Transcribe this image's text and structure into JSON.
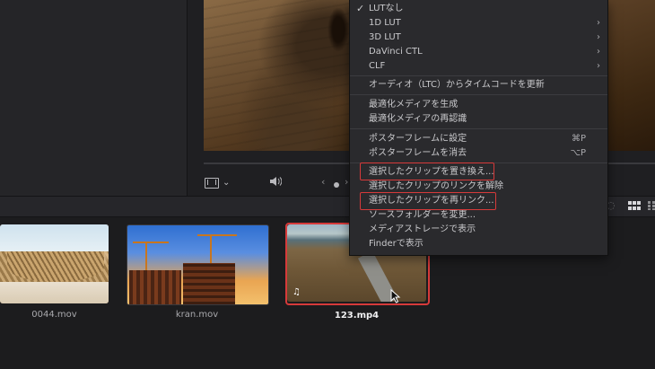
{
  "viewer": {
    "controls": [
      "film-icon",
      "chevron-down-icon",
      "volume-icon",
      "prev-icon",
      "dot-icon",
      "next-icon"
    ]
  },
  "context_menu": {
    "items": [
      {
        "label": "LUTなし",
        "checked": true,
        "submenu": false
      },
      {
        "label": "1D LUT",
        "checked": false,
        "submenu": true
      },
      {
        "label": "3D LUT",
        "checked": false,
        "submenu": true
      },
      {
        "label": "DaVinci CTL",
        "checked": false,
        "submenu": true
      },
      {
        "label": "CLF",
        "checked": false,
        "submenu": true
      },
      {
        "label": "オーディオ（LTC）からタイムコードを更新"
      },
      {
        "label": "最適化メディアを生成"
      },
      {
        "label": "最適化メディアの再認識"
      },
      {
        "label": "ポスターフレームに設定",
        "shortcut": "⌘P"
      },
      {
        "label": "ポスターフレームを消去",
        "shortcut": "⌥P"
      },
      {
        "label": "選択したクリップを置き換え...",
        "highlighted": true
      },
      {
        "label": "選択したクリップのリンクを解除"
      },
      {
        "label": "選択したクリップを再リンク...",
        "highlighted": true
      },
      {
        "label": "ソースフォルダーを変更..."
      },
      {
        "label": "メディアストレージで表示"
      },
      {
        "label": "Finderで表示"
      }
    ],
    "check_mark": "✓",
    "submenu_arrow": "›",
    "highlight_color": "#d63a3a"
  },
  "media_pool": {
    "clips": [
      {
        "name": "0044.mov",
        "selected": false
      },
      {
        "name": "kran.mov",
        "selected": false
      },
      {
        "name": "123.mp4",
        "selected": true,
        "badge": "♫"
      }
    ]
  },
  "colors": {
    "background": "#1c1c1e",
    "menu_background": "#2a2a2d",
    "selection": "#d63a3a"
  }
}
